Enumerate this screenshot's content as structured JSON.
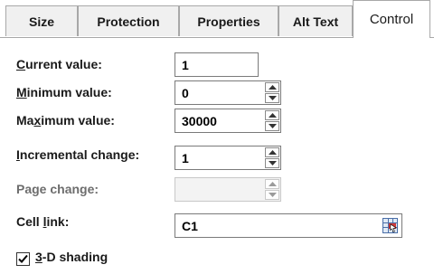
{
  "tabs": [
    {
      "label": "Size"
    },
    {
      "label": "Protection"
    },
    {
      "label": "Properties"
    },
    {
      "label": "Alt Text"
    },
    {
      "label": "Control"
    }
  ],
  "active_tab": "Control",
  "form": {
    "current_value": {
      "label_pre": "",
      "label_u": "C",
      "label_post": "urrent value:",
      "value": "1"
    },
    "minimum_value": {
      "label_pre": "",
      "label_u": "M",
      "label_post": "inimum value:",
      "value": "0"
    },
    "maximum_value": {
      "label_pre": "Ma",
      "label_u": "x",
      "label_post": "imum value:",
      "value": "30000"
    },
    "incremental_change": {
      "label_pre": "",
      "label_u": "I",
      "label_post": "ncremental change:",
      "value": "1"
    },
    "page_change": {
      "label": "Page change:",
      "value": "",
      "disabled": true
    },
    "cell_link": {
      "label_pre": "Cell ",
      "label_u": "l",
      "label_post": "ink:",
      "value": "C1"
    }
  },
  "shading": {
    "label_u": "3",
    "label_post": "-D shading",
    "checked": true
  },
  "icons": {
    "spin_up": "triangle-up-icon",
    "spin_down": "triangle-down-icon",
    "ref": "range-select-icon",
    "check": "checkmark-icon"
  }
}
